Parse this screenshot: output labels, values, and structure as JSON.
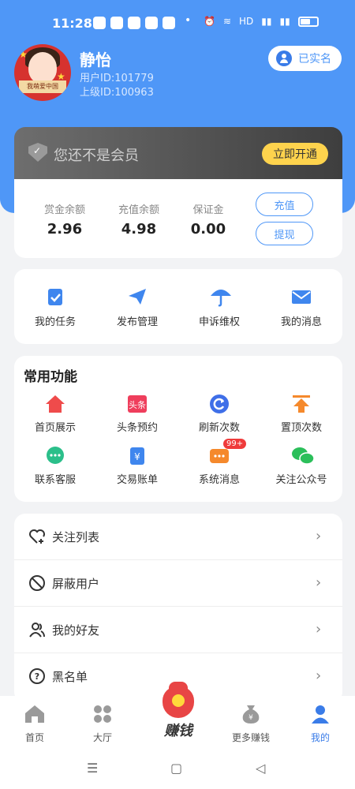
{
  "status_bar": {
    "time": "11:28",
    "net": "HD"
  },
  "profile": {
    "username": "静怡",
    "user_id": "用户ID:101779",
    "parent_id": "上级ID:100963",
    "verified_label": "已实名",
    "avatar_sign": "我萌爱中国"
  },
  "membership": {
    "text": "您还不是会员",
    "button": "立即开通"
  },
  "balance": {
    "items": [
      {
        "label": "赏金余额",
        "value": "2.96"
      },
      {
        "label": "充值余额",
        "value": "4.98"
      },
      {
        "label": "保证金",
        "value": "0.00"
      }
    ],
    "recharge": "充值",
    "withdraw": "提现"
  },
  "nav": [
    {
      "label": "我的任务",
      "icon": "clipboard-check-icon"
    },
    {
      "label": "发布管理",
      "icon": "paper-plane-icon"
    },
    {
      "label": "申诉维权",
      "icon": "umbrella-icon"
    },
    {
      "label": "我的消息",
      "icon": "envelope-icon"
    }
  ],
  "common": {
    "title": "常用功能",
    "items": [
      {
        "label": "首页展示",
        "icon": "home-icon"
      },
      {
        "label": "头条预约",
        "icon": "toutiao-icon"
      },
      {
        "label": "刷新次数",
        "icon": "refresh-icon"
      },
      {
        "label": "置顶次数",
        "icon": "pin-top-icon"
      },
      {
        "label": "联系客服",
        "icon": "chat-icon"
      },
      {
        "label": "交易账单",
        "icon": "bill-icon"
      },
      {
        "label": "系统消息",
        "icon": "message-icon",
        "badge": "99+"
      },
      {
        "label": "关注公众号",
        "icon": "wechat-icon"
      }
    ],
    "toutiao_text": "头条"
  },
  "list": [
    {
      "label": "关注列表",
      "icon": "heart-plus-icon"
    },
    {
      "label": "屏蔽用户",
      "icon": "block-icon"
    },
    {
      "label": "我的好友",
      "icon": "friends-icon"
    },
    {
      "label": "黑名单",
      "icon": "question-icon"
    }
  ],
  "tabbar": {
    "home": "首页",
    "hall": "大厅",
    "earn": "赚钱",
    "more": "更多赚钱",
    "mine": "我的"
  },
  "colors": {
    "primary": "#4f97f7",
    "gold": "#fed34d"
  }
}
